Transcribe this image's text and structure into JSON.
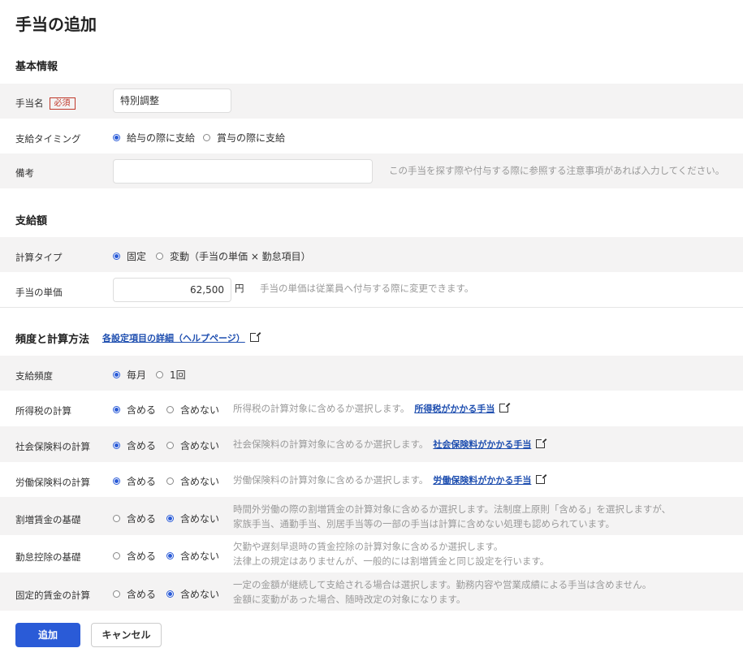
{
  "page_title": "手当の追加",
  "sections": {
    "basic": "基本情報",
    "amount": "支給額",
    "frequency": "頻度と計算方法"
  },
  "help_link": "各設定項目の詳細（ヘルプページ）",
  "fields": {
    "name": {
      "label": "手当名",
      "required": "必須",
      "value": "特別調整"
    },
    "timing": {
      "label": "支給タイミング",
      "opt1": "給与の際に支給",
      "opt2": "賞与の際に支給"
    },
    "memo": {
      "label": "備考",
      "hint": "この手当を探す際や付与する際に参照する注意事項があれば入力してください。"
    },
    "calc_type": {
      "label": "計算タイプ",
      "opt1": "固定",
      "opt2": "変動（手当の単価 × 勤怠項目）"
    },
    "unit_price": {
      "label": "手当の単価",
      "value": "62,500",
      "unit": "円",
      "hint": "手当の単価は従業員へ付与する際に変更できます。"
    },
    "frequency": {
      "label": "支給頻度",
      "opt1": "毎月",
      "opt2": "1回"
    }
  },
  "calc_rows": [
    {
      "label": "所得税の計算",
      "selected": 1,
      "hint1": "所得税の計算対象に含めるか選択します。",
      "link": "所得税がかかる手当",
      "hint2": ""
    },
    {
      "label": "社会保険料の計算",
      "selected": 1,
      "hint1": "社会保険料の計算対象に含めるか選択します。",
      "link": "社会保険料がかかる手当",
      "hint2": ""
    },
    {
      "label": "労働保険料の計算",
      "selected": 1,
      "hint1": "労働保険料の計算対象に含めるか選択します。",
      "link": "労働保険料がかかる手当",
      "hint2": ""
    },
    {
      "label": "割増賃金の基礎",
      "selected": 2,
      "hint1": "時間外労働の際の割増賃金の計算対象に含めるか選択します。法制度上原則「含める」を選択しますが、",
      "link": "",
      "hint2": "家族手当、通勤手当、別居手当等の一部の手当は計算に含めない処理も認められています。"
    },
    {
      "label": "勤怠控除の基礎",
      "selected": 2,
      "hint1": "欠勤や遅刻早退時の賃金控除の計算対象に含めるか選択します。",
      "link": "",
      "hint2": "法律上の規定はありませんが、一般的には割増賃金と同じ設定を行います。"
    },
    {
      "label": "固定的賃金の計算",
      "selected": 2,
      "hint1": "一定の金額が継続して支給される場合は選択します。勤務内容や営業成績による手当は含めません。",
      "link": "",
      "hint2": "金額に変動があった場合、随時改定の対象になります。"
    }
  ],
  "options": {
    "include": "含める",
    "exclude": "含めない"
  },
  "buttons": {
    "add": "追加",
    "cancel": "キャンセル"
  },
  "colors": {
    "accent": "#2a5bd7",
    "required": "#c0392b",
    "row_bg": "#f4f3f3"
  }
}
